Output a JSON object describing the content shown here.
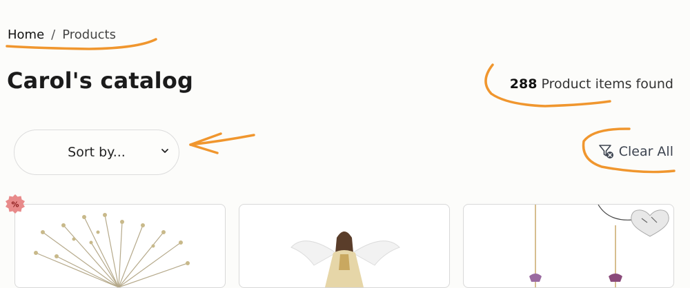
{
  "breadcrumb": {
    "home": "Home",
    "separator": "/",
    "current": "Products"
  },
  "page_title": "Carol's catalog",
  "results": {
    "count": "288",
    "label": "Product items found"
  },
  "sort": {
    "label": "Sort by...",
    "icon": "chevron-down-icon"
  },
  "filters": {
    "clear_label": "Clear All",
    "icon": "filter-clear-icon"
  },
  "badge": {
    "icon": "discount-percent-icon",
    "symbol": "%"
  },
  "products": [
    {
      "image": "gold-spray-ornament"
    },
    {
      "image": "angel-tree-topper"
    },
    {
      "image": "goodwill-heart-ornament"
    }
  ],
  "colors": {
    "annotation": "#f0962e",
    "badge": "#e88a8a",
    "text": "#1b1b1b"
  }
}
